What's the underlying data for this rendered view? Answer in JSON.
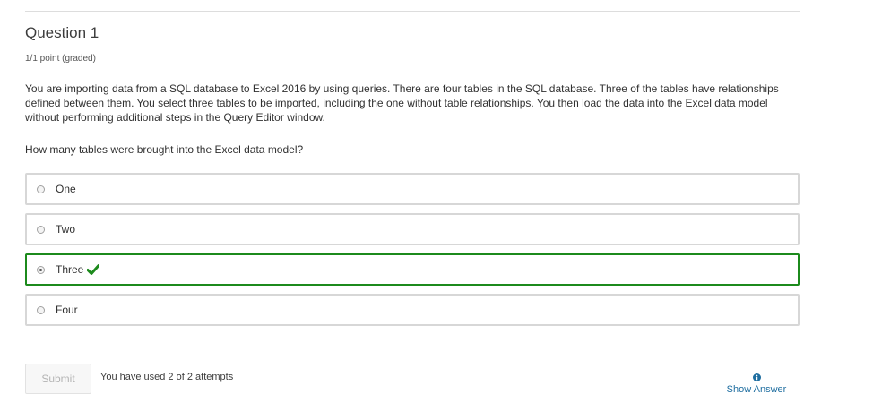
{
  "question": {
    "title": "Question 1",
    "points": "1/1 point (graded)",
    "stem": "You are importing data from a SQL database to Excel 2016 by using queries. There are four tables in the SQL database. Three of the tables have relationships defined between them. You select three tables to be imported, including the one without table relationships. You then load the data into the Excel data model without performing additional steps in the Query Editor window.",
    "prompt": "How many tables were brought into the Excel data model?",
    "choices": [
      {
        "label": "One",
        "selected": false,
        "correct": false
      },
      {
        "label": "Two",
        "selected": false,
        "correct": false
      },
      {
        "label": "Three",
        "selected": true,
        "correct": true
      },
      {
        "label": "Four",
        "selected": false,
        "correct": false
      }
    ]
  },
  "actions": {
    "submit_label": "Submit",
    "attempts_text": "You have used 2 of 2 attempts",
    "show_answer_label": "Show Answer"
  },
  "icons": {
    "correct": "checkmark-icon",
    "info": "info-icon"
  },
  "colors": {
    "correct_border": "#1c8a1c",
    "check": "#1c8a1c",
    "link": "#1f6ea0"
  }
}
